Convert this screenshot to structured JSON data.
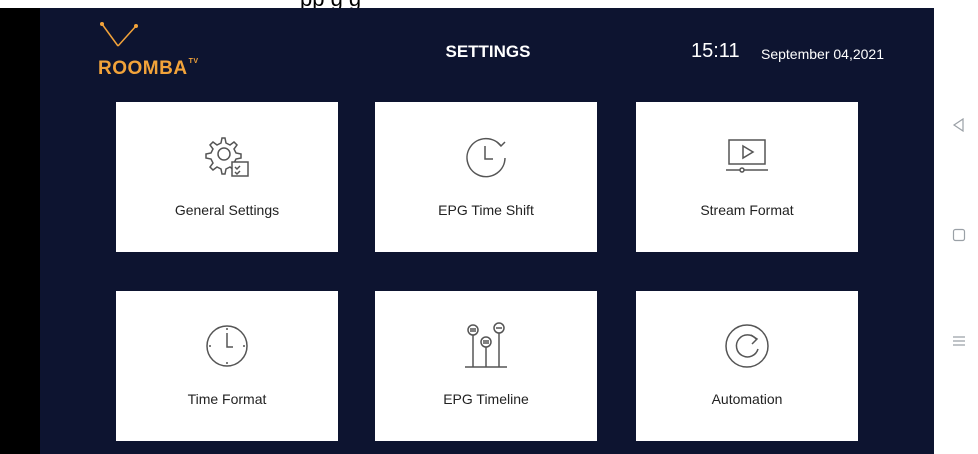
{
  "app": {
    "title": "SETTINGS",
    "time": "15:11",
    "date": "September 04,2021",
    "logo_text": "ROOMBA",
    "logo_suffix": "TV",
    "top_text": "pp                                                          g          g"
  },
  "tiles": [
    {
      "label": "General Settings",
      "icon": "gear-checklist-icon"
    },
    {
      "label": "EPG Time Shift",
      "icon": "clock-refresh-icon"
    },
    {
      "label": "Stream Format",
      "icon": "video-player-icon"
    },
    {
      "label": "Time Format",
      "icon": "analog-clock-icon"
    },
    {
      "label": "EPG Timeline",
      "icon": "timeline-sliders-icon"
    },
    {
      "label": "Automation",
      "icon": "circular-arrow-icon"
    }
  ],
  "colors": {
    "background": "#0d1430",
    "tile": "#ffffff",
    "logo_accent": "#f2a33a",
    "icon_stroke": "#555555"
  },
  "nav": {
    "icons": [
      "back-triangle-icon",
      "home-square-icon",
      "menu-lines-icon"
    ]
  }
}
